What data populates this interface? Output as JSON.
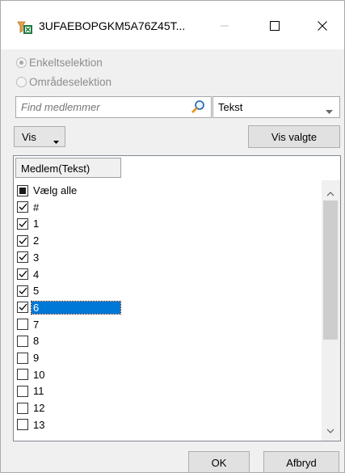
{
  "window": {
    "title": "3UFAEBOPGKM5A76Z45T...",
    "app_icon": "excel-filter-icon",
    "minimize_icon": "minimize-icon",
    "maximize_icon": "maximize-icon",
    "close_icon": "close-icon"
  },
  "selection_mode": {
    "options": [
      {
        "label": "Enkeltselektion",
        "checked": true,
        "enabled": false
      },
      {
        "label": "Områdeselektion",
        "checked": false,
        "enabled": false
      }
    ]
  },
  "search": {
    "placeholder": "Find medlemmer",
    "value": "",
    "icon": "search-icon"
  },
  "type_select": {
    "value": "Tekst"
  },
  "toolbar": {
    "vis_label": "Vis",
    "vis_valgte_label": "Vis valgte"
  },
  "list": {
    "column_header": "Medlem(Tekst)",
    "items": [
      {
        "label": "Vælg alle",
        "state": "partial"
      },
      {
        "label": "#",
        "state": "checked"
      },
      {
        "label": "1",
        "state": "checked"
      },
      {
        "label": "2",
        "state": "checked"
      },
      {
        "label": "3",
        "state": "checked"
      },
      {
        "label": "4",
        "state": "checked"
      },
      {
        "label": "5",
        "state": "checked"
      },
      {
        "label": "6",
        "state": "checked",
        "selected": true
      },
      {
        "label": "7",
        "state": "unchecked"
      },
      {
        "label": "8",
        "state": "unchecked"
      },
      {
        "label": "9",
        "state": "unchecked"
      },
      {
        "label": "10",
        "state": "unchecked"
      },
      {
        "label": "11",
        "state": "unchecked"
      },
      {
        "label": "12",
        "state": "unchecked"
      },
      {
        "label": "13",
        "state": "unchecked"
      }
    ],
    "selected_color": "#0078d7"
  },
  "footer": {
    "ok_label": "OK",
    "cancel_label": "Afbryd"
  }
}
